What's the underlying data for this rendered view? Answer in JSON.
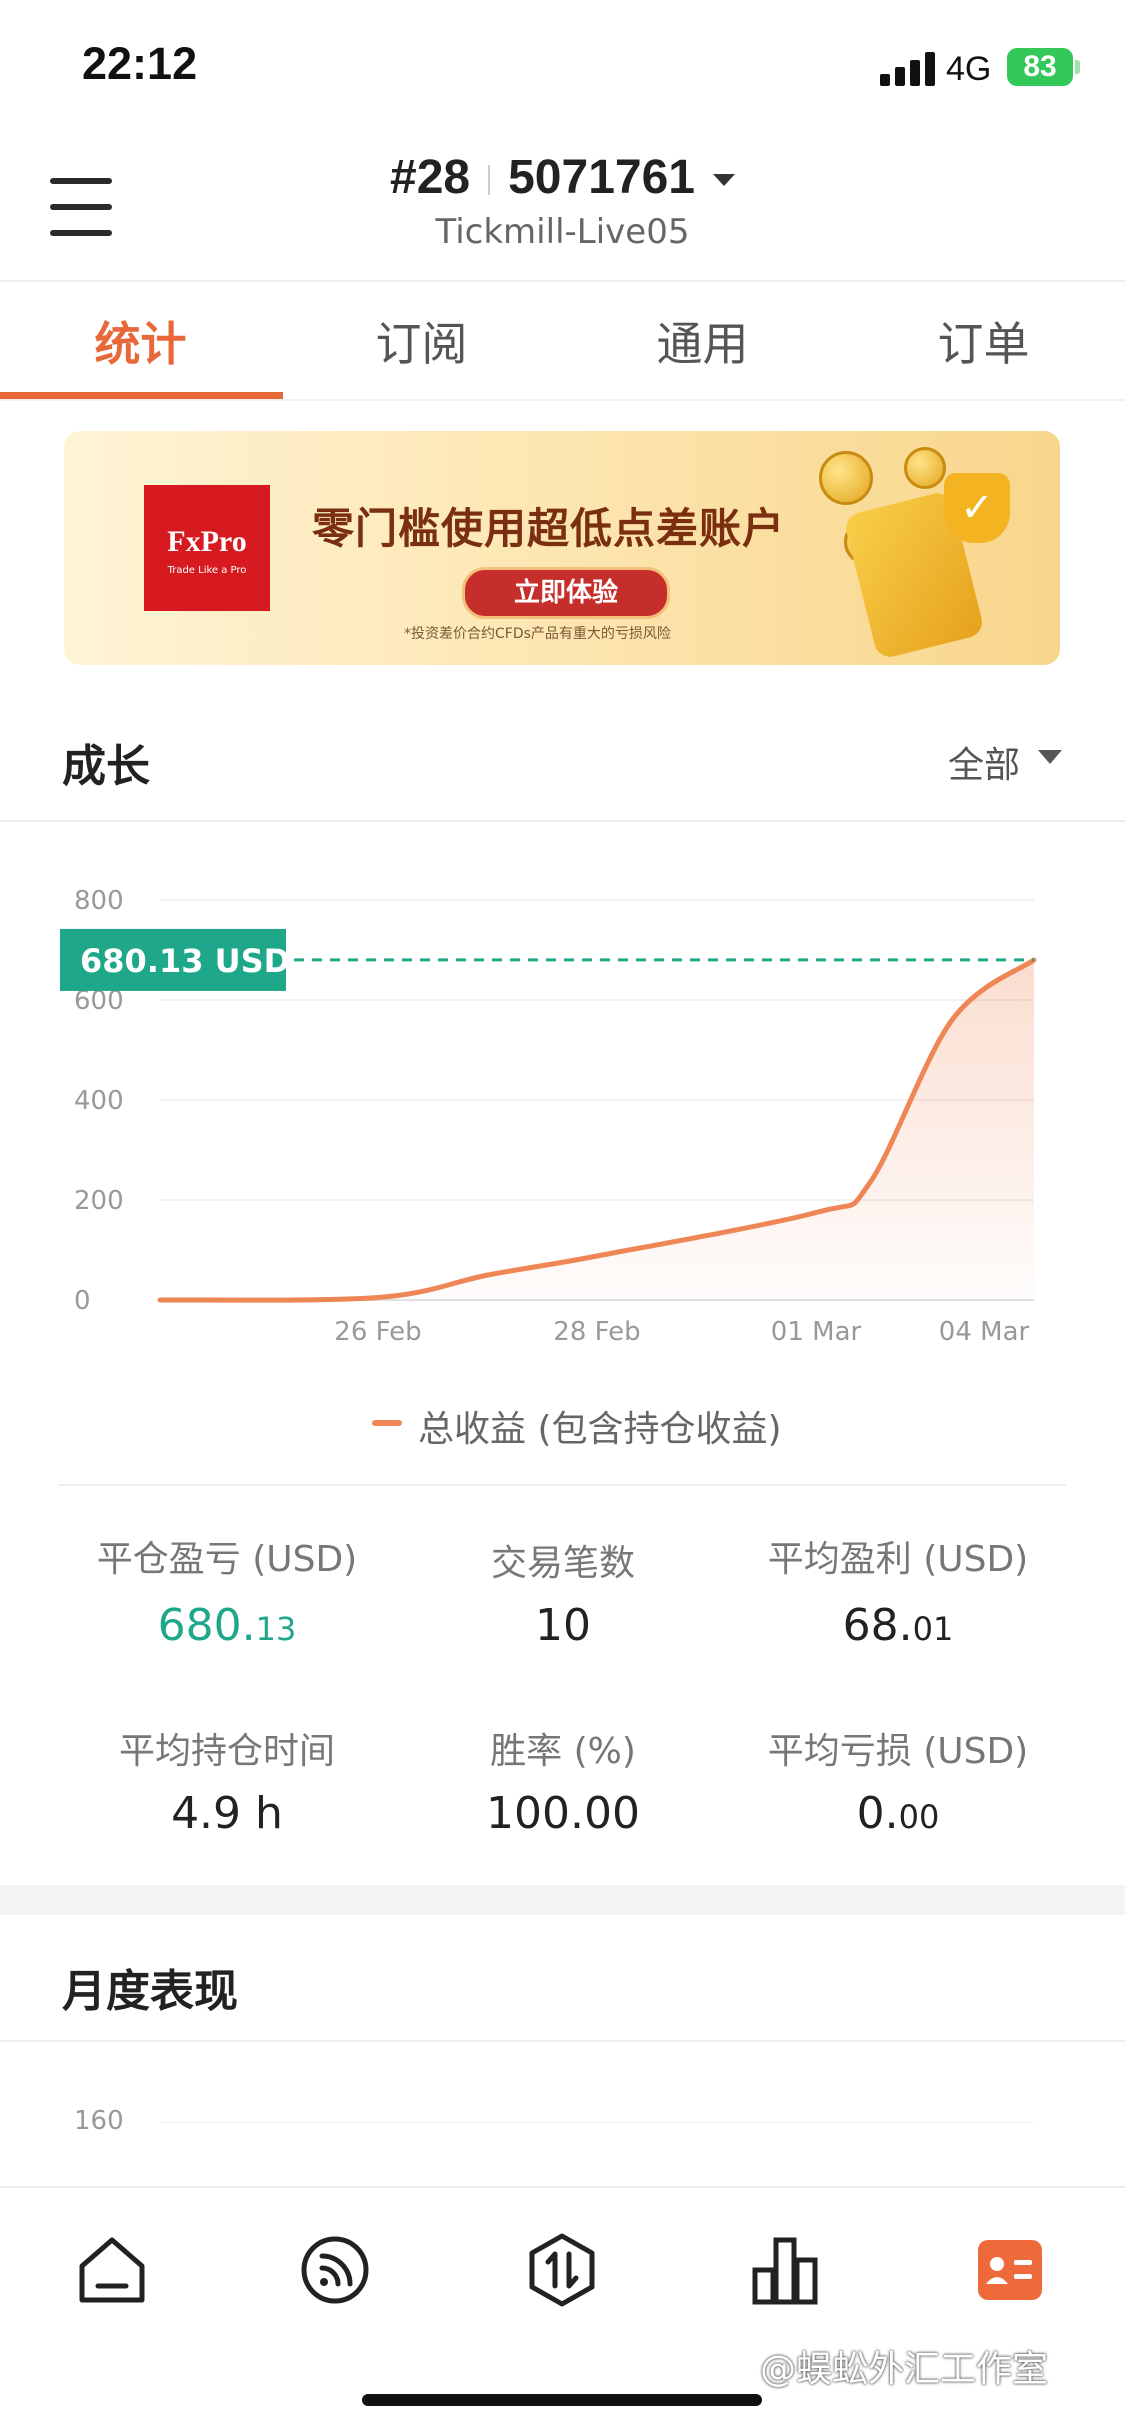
{
  "status_bar": {
    "time": "22:12",
    "network": "4G",
    "battery": "83"
  },
  "header": {
    "account_rank": "#28",
    "account_number": "5071761",
    "server": "Tickmill-Live05"
  },
  "tabs": [
    {
      "label": "统计",
      "active": true
    },
    {
      "label": "订阅",
      "active": false
    },
    {
      "label": "通用",
      "active": false
    },
    {
      "label": "订单",
      "active": false
    }
  ],
  "banner": {
    "brand": "FxPro",
    "brand_tagline": "Trade Like a Pro",
    "headline": "零门槛使用超低点差账户",
    "cta": "立即体验",
    "disclaimer": "*投资差价合约CFDs产品有重大的亏损风险"
  },
  "growth": {
    "title": "成长",
    "filter": "全部",
    "current_value_label": "680.13 USD",
    "legend": "总收益 (包含持仓收益)"
  },
  "chart_data": {
    "type": "area",
    "title": "",
    "xlabel": "",
    "ylabel": "",
    "ylim": [
      0,
      800
    ],
    "yticks": [
      0,
      200,
      400,
      600,
      800
    ],
    "xticks": [
      "26 Feb",
      "28 Feb",
      "01 Mar",
      "04 Mar"
    ],
    "series": [
      {
        "name": "总收益 (包含持仓收益)",
        "color": "#ef8656",
        "x": [
          "24 Feb",
          "26 Feb",
          "27 Feb",
          "28 Feb",
          "01 Mar",
          "02 Mar",
          "03 Mar",
          "04 Mar"
        ],
        "y": [
          0,
          5,
          50,
          88,
          175,
          235,
          560,
          680.13
        ]
      }
    ],
    "reference_line": {
      "value": 680.13,
      "label": "680.13 USD",
      "color": "#1fa78a"
    },
    "grid": true
  },
  "stats": [
    {
      "label": "平仓盈亏 (USD)",
      "value_int": "680.",
      "value_dec": "13",
      "color": "green"
    },
    {
      "label": "交易笔数",
      "value_int": "10",
      "value_dec": ""
    },
    {
      "label": "平均盈利 (USD)",
      "value_int": "68.",
      "value_dec": "01"
    },
    {
      "label": "平均持仓时间",
      "value_int": "4.9 h",
      "value_dec": ""
    },
    {
      "label": "胜率 (%)",
      "value_int": "100.00",
      "value_dec": ""
    },
    {
      "label": "平均亏损 (USD)",
      "value_int": "0.",
      "value_dec": "00"
    }
  ],
  "monthly": {
    "title": "月度表现",
    "y_top_tick": "160"
  },
  "bottom_nav": [
    {
      "icon": "home-icon",
      "active": false
    },
    {
      "icon": "signal-feed-icon",
      "active": false
    },
    {
      "icon": "trade-icon",
      "active": false
    },
    {
      "icon": "chart-bar-icon",
      "active": false
    },
    {
      "icon": "account-card-icon",
      "active": true
    }
  ],
  "watermark": "@蜈蚣外汇工作室",
  "colors": {
    "accent": "#e8683a",
    "positive": "#1fa78a",
    "line": "#ef8656"
  }
}
